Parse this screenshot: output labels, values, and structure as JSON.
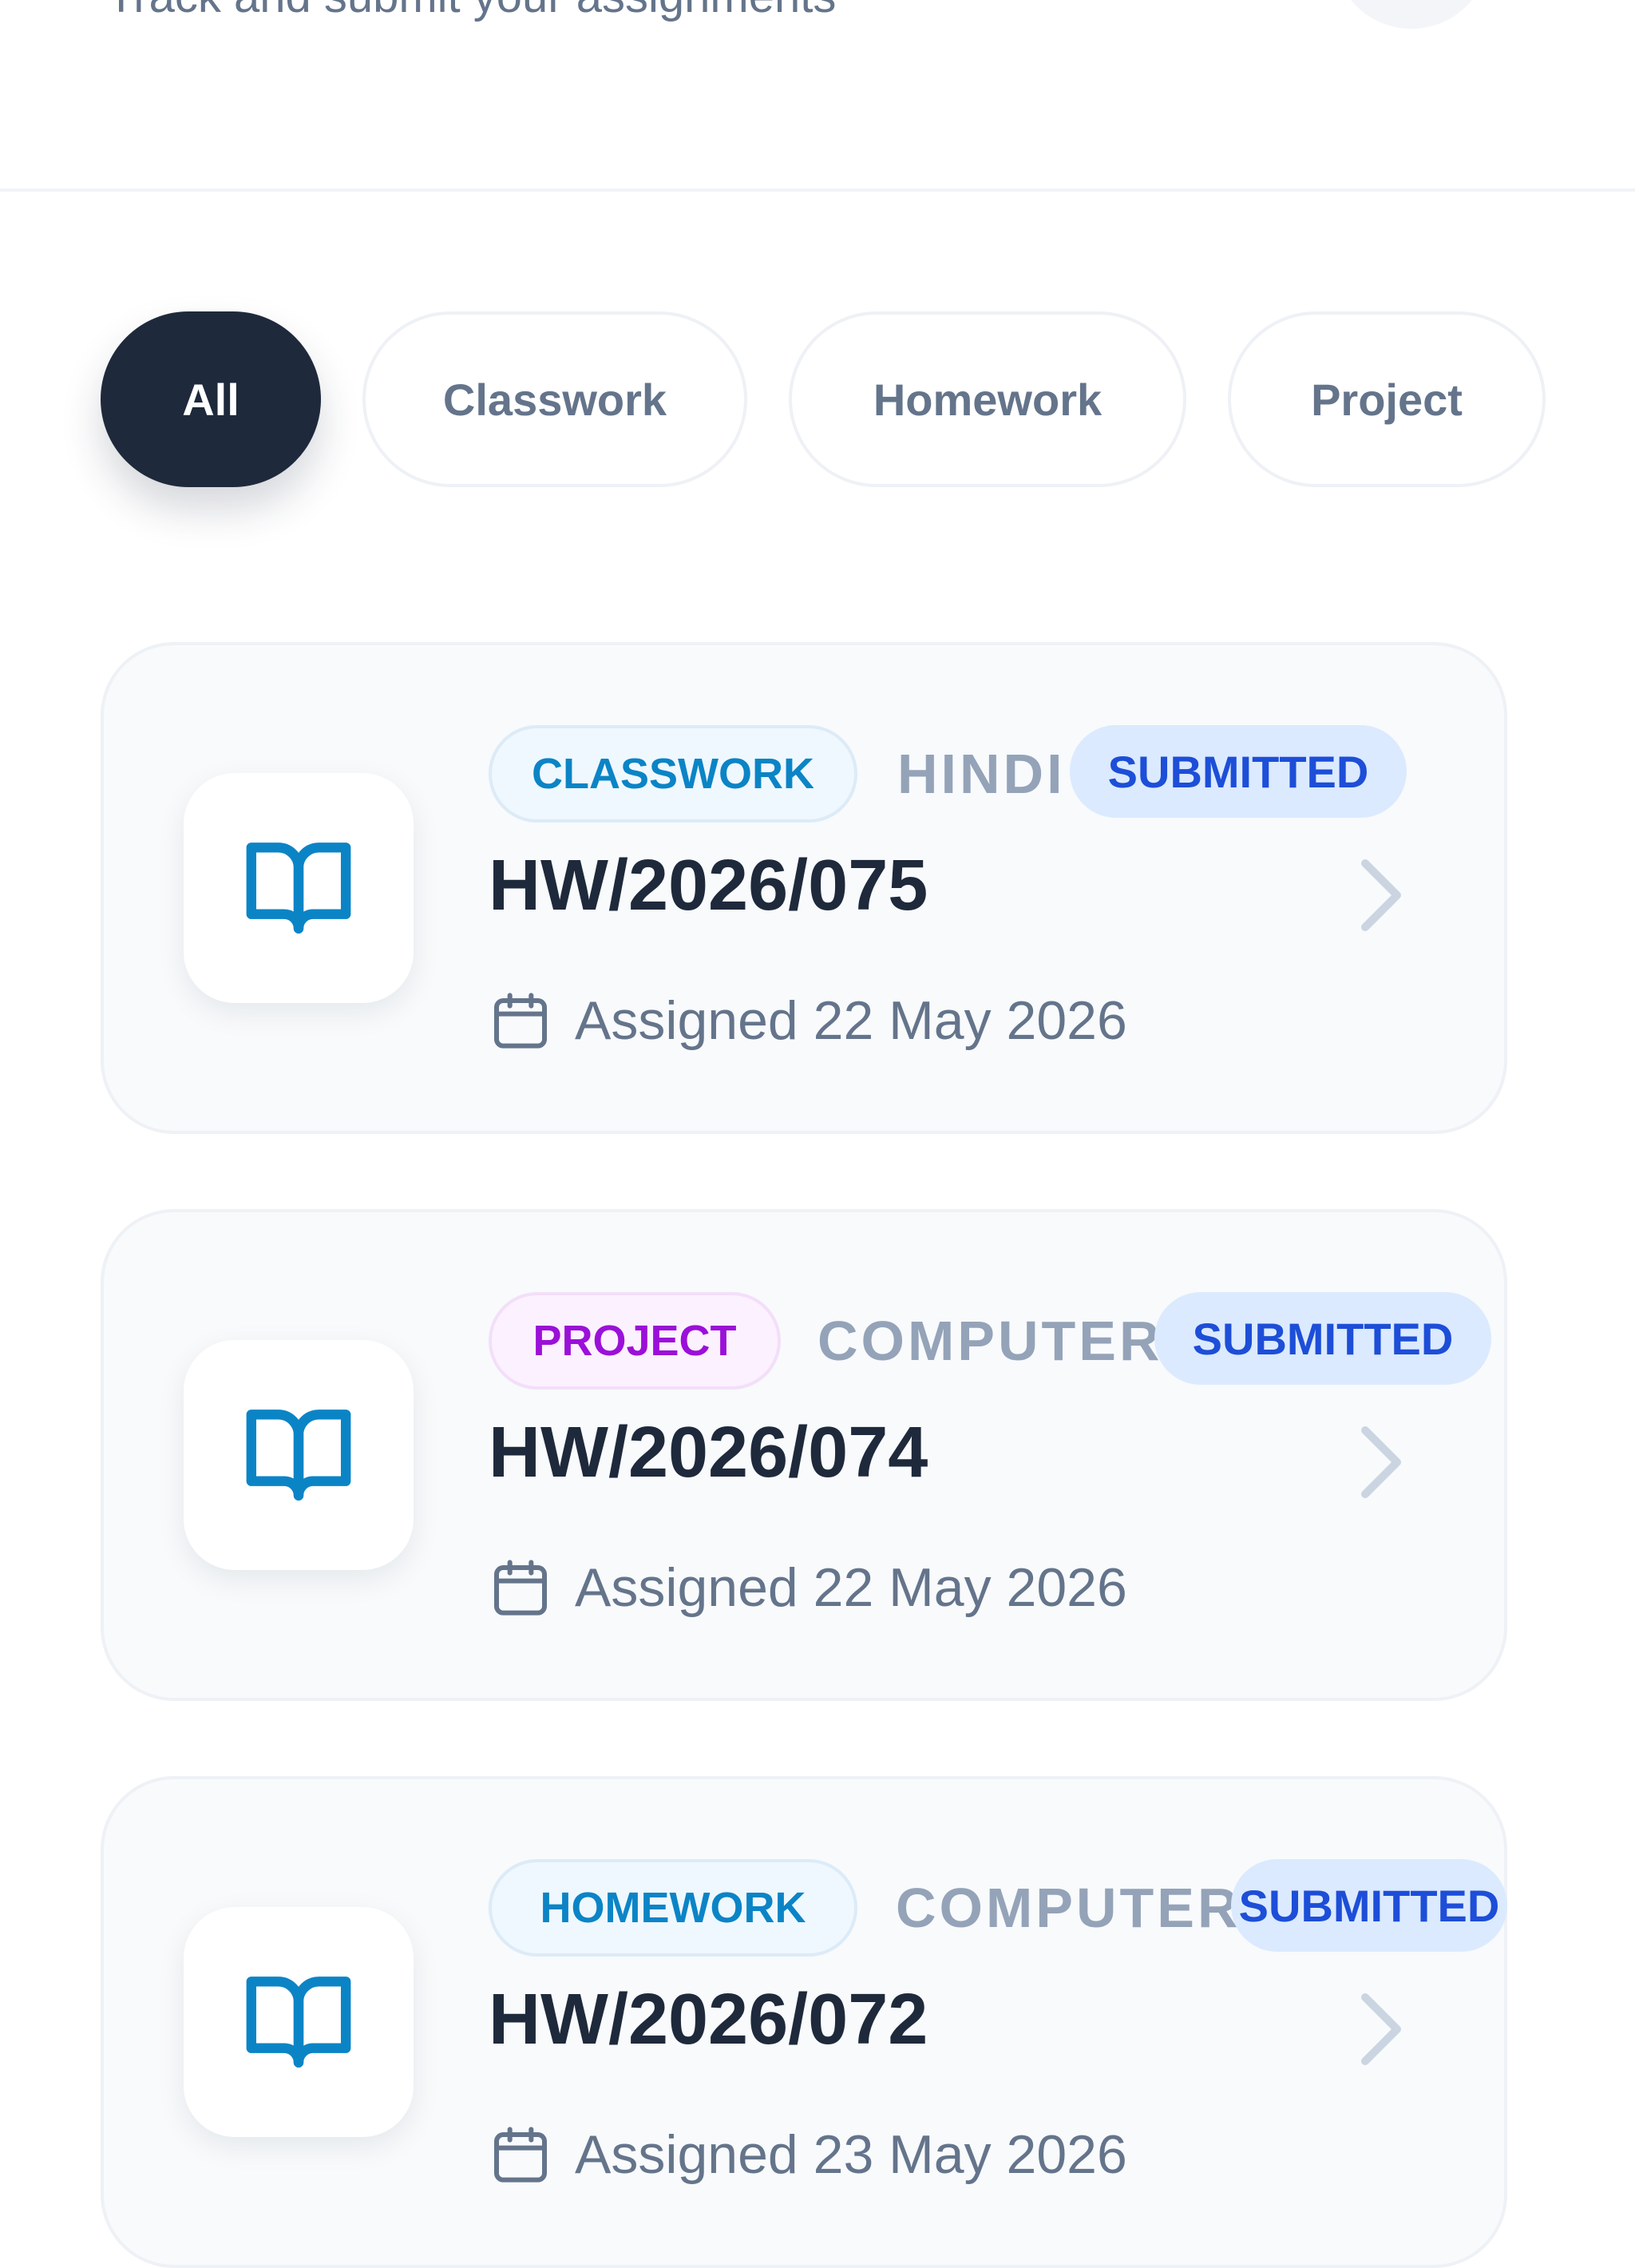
{
  "header": {
    "subtitle": "Track and submit your assignments"
  },
  "filters": [
    {
      "label": "All",
      "active": true
    },
    {
      "label": "Classwork",
      "active": false
    },
    {
      "label": "Homework",
      "active": false
    },
    {
      "label": "Project",
      "active": false
    }
  ],
  "assignments": [
    {
      "type": "CLASSWORK",
      "subject": "HINDI",
      "status": "SUBMITTED",
      "id": "HW/2026/075",
      "assigned": "Assigned 22 May 2026"
    },
    {
      "type": "PROJECT",
      "subject": "COMPUTER",
      "status": "SUBMITTED",
      "id": "HW/2026/074",
      "assigned": "Assigned 22 May 2026"
    },
    {
      "type": "HOMEWORK",
      "subject": "COMPUTER",
      "status": "SUBMITTED",
      "id": "HW/2026/072",
      "assigned": "Assigned 23 May 2026"
    }
  ],
  "colors": {
    "accent": "#1e293b",
    "icon": "#0b84c6",
    "status_bg": "#dbeafe",
    "status_text": "#1d4ed8",
    "project_tag": "#9b10d8"
  },
  "icons": {
    "card": "open-book-icon",
    "date": "calendar-icon",
    "navigate": "chevron-right-icon"
  }
}
